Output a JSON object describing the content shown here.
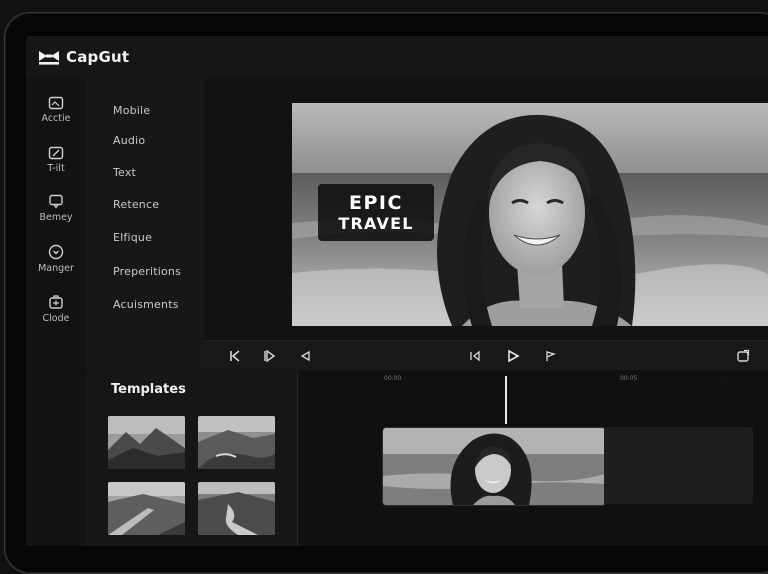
{
  "app": {
    "title": "CapGut"
  },
  "icon_bar": {
    "items": [
      {
        "label": "Acctie",
        "icon": "media-icon"
      },
      {
        "label": "T-ilt",
        "icon": "edit-icon"
      },
      {
        "label": "Bemey",
        "icon": "chat-icon"
      },
      {
        "label": "Manger",
        "icon": "circle-chevron-icon"
      },
      {
        "label": "Clode",
        "icon": "layers-icon"
      }
    ]
  },
  "side_menu": {
    "items": [
      "Mobile",
      "Audio",
      "Text",
      "Retence",
      "Elfique",
      "Preperitions",
      "Acuisments"
    ]
  },
  "preview": {
    "overlay_line1": "EPIC",
    "overlay_line2": "TRAVEL"
  },
  "templates": {
    "heading": "Templates",
    "items": [
      {
        "icon": "mountain-thumbnail"
      },
      {
        "icon": "coast-thumbnail"
      },
      {
        "icon": "valley-road-thumbnail"
      },
      {
        "icon": "waterfall-thumbnail"
      }
    ]
  },
  "timeline": {
    "tick_1": "00:00",
    "tick_2": "00:05",
    "tick_3": "·"
  },
  "colors": {
    "background": "#111111",
    "panel": "#161616",
    "accent": "#ffffff"
  }
}
